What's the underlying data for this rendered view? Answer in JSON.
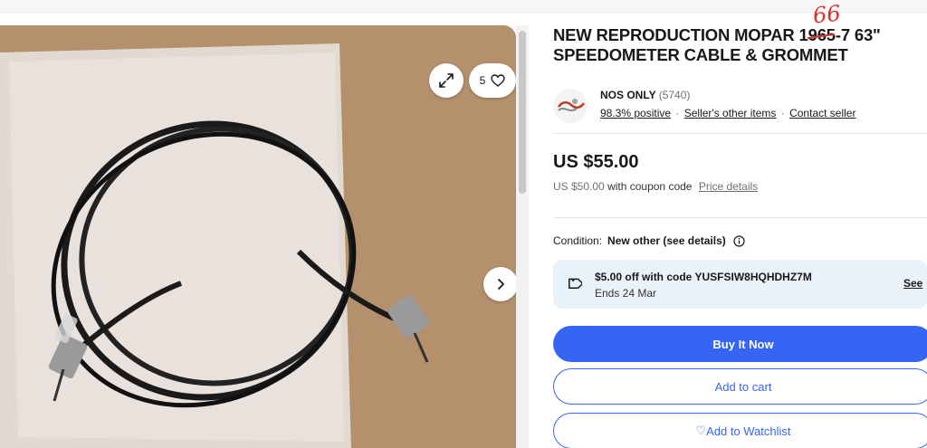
{
  "gallery": {
    "image_count": "5",
    "expand_icon": "expand-icon",
    "heart_icon": "heart-icon",
    "next_icon": "chevron-right-icon"
  },
  "listing": {
    "title": "NEW REPRODUCTION MOPAR 1965-7 63\" SPEEDOMETER CABLE & GROMMET",
    "title_annotation": "66"
  },
  "seller": {
    "name": "NOS ONLY",
    "feedback_count": "(5740)",
    "positive": "98.3% positive",
    "other_items": "Seller's other items",
    "contact": "Contact seller",
    "separator": "·"
  },
  "pricing": {
    "price": "US $55.00",
    "coupon_price": "US $50.00",
    "coupon_text": "with coupon code",
    "details_link": "Price details"
  },
  "condition": {
    "label": "Condition:",
    "value": "New other (see details)"
  },
  "coupon": {
    "title": "$5.00 off with code YUSFSIW8HQHDHZ7M",
    "ends": "Ends 24 Mar",
    "see_link": "See"
  },
  "actions": {
    "buy_now": "Buy It Now",
    "add_to_cart": "Add to cart",
    "watchlist": "Add to Watchlist",
    "watchlist_icon": "♡"
  },
  "colors": {
    "primary": "#3665f3",
    "annotation": "#d9332b",
    "coupon_bg": "#eaf2f9"
  }
}
